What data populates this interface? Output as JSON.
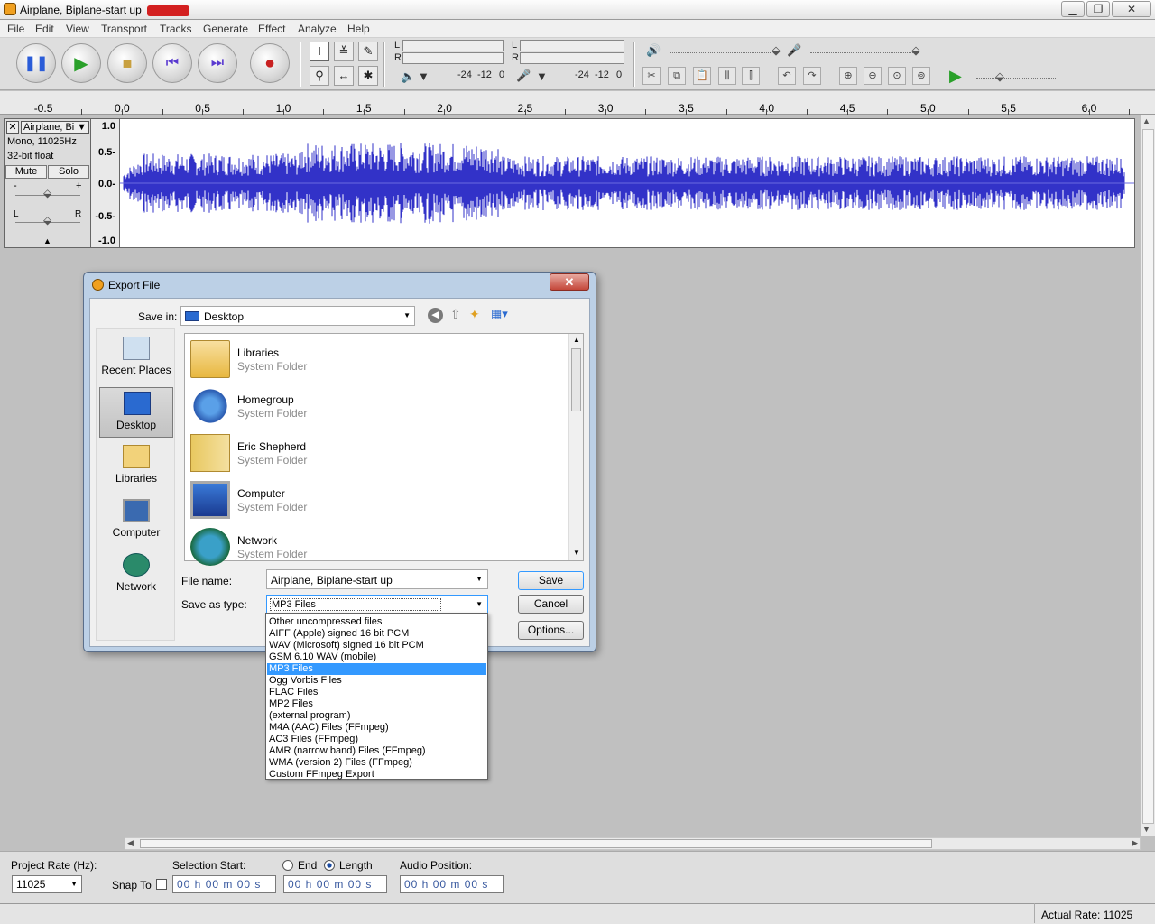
{
  "window": {
    "title": "Airplane, Biplane-start up"
  },
  "menu": [
    "File",
    "Edit",
    "View",
    "Transport",
    "Tracks",
    "Generate",
    "Effect",
    "Analyze",
    "Help"
  ],
  "meters": {
    "ticks_left": [
      "-24",
      "-12",
      "0"
    ],
    "ticks_right": [
      "-24",
      "-12",
      "0"
    ],
    "ch_l": "L",
    "ch_r": "R"
  },
  "ruler": [
    "-0.5",
    "0.0",
    "0.5",
    "1.0",
    "1.5",
    "2.0",
    "2.5",
    "3.0",
    "3.5",
    "4.0",
    "4.5",
    "5.0",
    "5.5",
    "6.0"
  ],
  "track": {
    "name": "Airplane, Bi",
    "info1": "Mono, 11025Hz",
    "info2": "32-bit float",
    "mute": "Mute",
    "solo": "Solo",
    "gain_min": "-",
    "gain_max": "+",
    "pan_l": "L",
    "pan_r": "R",
    "vlabels": [
      "1.0",
      "0.5-",
      "0.0-",
      "-0.5-",
      "-1.0"
    ]
  },
  "dialog": {
    "title": "Export File",
    "save_in_label": "Save in:",
    "save_in_value": "Desktop",
    "places": [
      "Recent Places",
      "Desktop",
      "Libraries",
      "Computer",
      "Network"
    ],
    "files": [
      {
        "name": "Libraries",
        "type": "System Folder"
      },
      {
        "name": "Homegroup",
        "type": "System Folder"
      },
      {
        "name": "Eric Shepherd",
        "type": "System Folder"
      },
      {
        "name": "Computer",
        "type": "System Folder"
      },
      {
        "name": "Network",
        "type": "System Folder"
      }
    ],
    "file_name_label": "File name:",
    "file_name_value": "Airplane, Biplane-start up",
    "save_type_label": "Save as type:",
    "save_type_value": "MP3 Files",
    "save_button": "Save",
    "cancel_button": "Cancel",
    "options_button": "Options...",
    "type_options": [
      "Other uncompressed files",
      "AIFF (Apple) signed 16 bit PCM",
      "WAV (Microsoft) signed 16 bit PCM",
      "GSM 6.10 WAV (mobile)",
      "MP3 Files",
      "Ogg Vorbis Files",
      "FLAC Files",
      "MP2 Files",
      "(external program)",
      "M4A (AAC) Files (FFmpeg)",
      "AC3 Files (FFmpeg)",
      "AMR (narrow band) Files (FFmpeg)",
      "WMA (version 2) Files (FFmpeg)",
      "Custom FFmpeg Export"
    ],
    "selected_type_index": 4
  },
  "selection": {
    "project_rate_label": "Project Rate (Hz):",
    "project_rate_value": "11025",
    "snap_label": "Snap To",
    "sel_start_label": "Selection Start:",
    "end_label": "End",
    "length_label": "Length",
    "audio_pos_label": "Audio Position:",
    "time_value": "00 h 00 m 00 s"
  },
  "status": {
    "actual_rate": "Actual Rate: 11025"
  },
  "colors": {
    "waveform": "#3232c8",
    "selected_item": "#3399ff"
  }
}
